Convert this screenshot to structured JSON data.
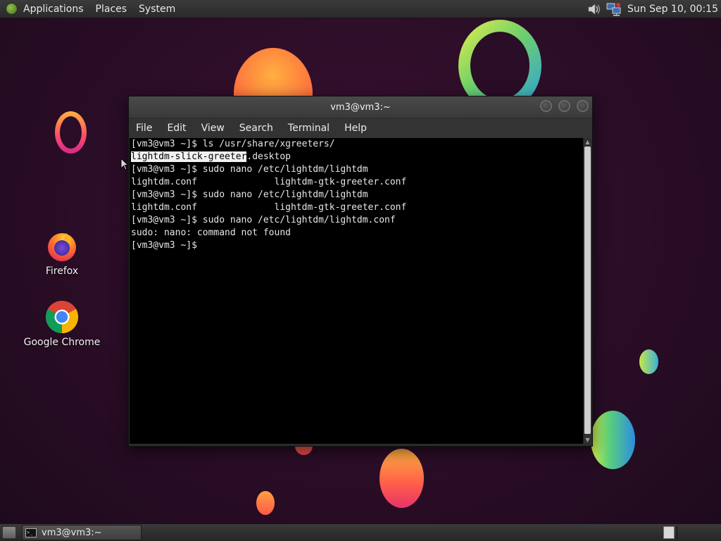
{
  "top_panel": {
    "menus": [
      "Applications",
      "Places",
      "System"
    ],
    "clock": "Sun Sep 10, 00:15",
    "tray_icons": [
      "volume-icon",
      "network-icon"
    ]
  },
  "desktop": {
    "icons": [
      {
        "label": "Firefox",
        "icon": "firefox-icon"
      },
      {
        "label": "Google Chrome",
        "icon": "chrome-icon"
      }
    ]
  },
  "terminal": {
    "title": "vm3@vm3:~",
    "menu": [
      "File",
      "Edit",
      "View",
      "Search",
      "Terminal",
      "Help"
    ],
    "lines": {
      "l0": "[vm3@vm3 ~]$ ls /usr/share/xgreeters/",
      "l1_highlight": "lightdm-slick-greeter",
      "l1_rest": ".desktop",
      "l2": "[vm3@vm3 ~]$ sudo nano /etc/lightdm/lightdm",
      "l3": "lightdm.conf              lightdm-gtk-greeter.conf",
      "l4": "[vm3@vm3 ~]$ sudo nano /etc/lightdm/lightdm",
      "l5": "lightdm.conf              lightdm-gtk-greeter.conf",
      "l6": "[vm3@vm3 ~]$ sudo nano /etc/lightdm/lightdm.conf",
      "l7": "sudo: nano: command not found",
      "l8": "[vm3@vm3 ~]$ "
    }
  },
  "bottom_panel": {
    "task_label": "vm3@vm3:~",
    "task_icon_text": ">_"
  },
  "colors": {
    "desktop_bg": "#2a0d26",
    "terminal_bg": "#000000",
    "terminal_fg": "#e6e6e6"
  }
}
